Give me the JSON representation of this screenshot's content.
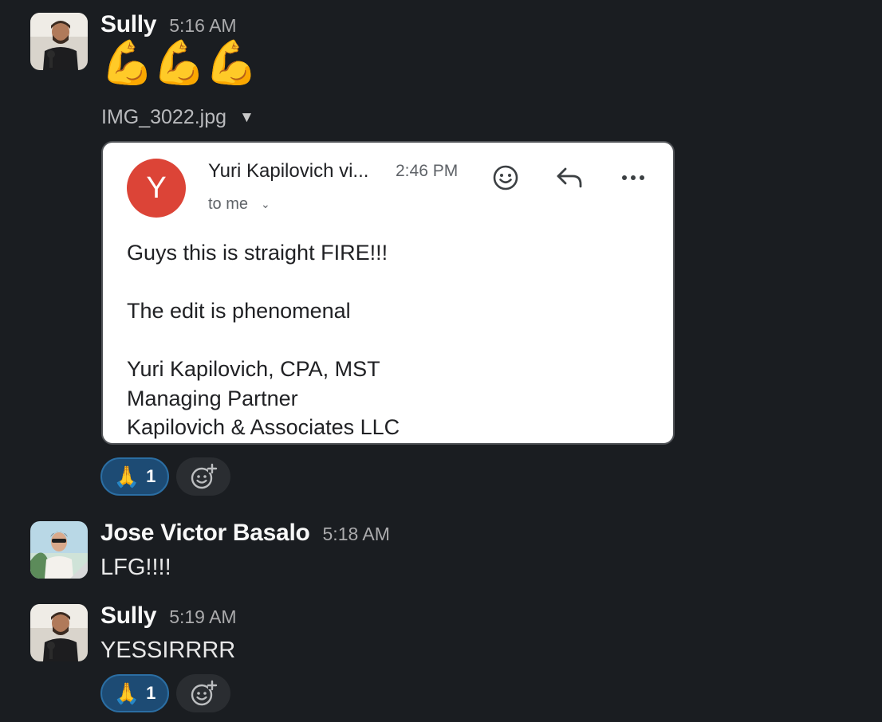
{
  "messages": [
    {
      "author": "Sully",
      "time": "5:16 AM",
      "emojis": "💪💪💪",
      "attachment": {
        "filename": "IMG_3022.jpg",
        "email": {
          "avatar_letter": "Y",
          "sender": "Yuri Kapilovich vi...",
          "time": "2:46 PM",
          "to": "to me",
          "body": [
            "Guys this is straight FIRE!!!",
            "The edit is phenomenal",
            "Yuri Kapilovich, CPA, MST",
            "Managing Partner",
            "Kapilovich & Associates LLC"
          ]
        }
      },
      "reaction": {
        "emoji": "🙏",
        "count": "1"
      }
    },
    {
      "author": "Jose Victor Basalo",
      "time": "5:18 AM",
      "text": "LFG!!!!"
    },
    {
      "author": "Sully",
      "time": "5:19 AM",
      "text": "YESSIRRRR",
      "reaction": {
        "emoji": "🙏",
        "count": "1"
      }
    }
  ],
  "icons": {
    "file_toggle": "caret-down-icon",
    "email_emoji": "smiley-icon",
    "email_reply": "reply-icon",
    "email_more": "more-icon",
    "add_reaction": "add-reaction-icon"
  },
  "colors": {
    "background": "#1a1d21",
    "reaction_bg": "#1d4b74",
    "reaction_border": "#2b6ea3",
    "email_avatar": "#dc4437"
  }
}
